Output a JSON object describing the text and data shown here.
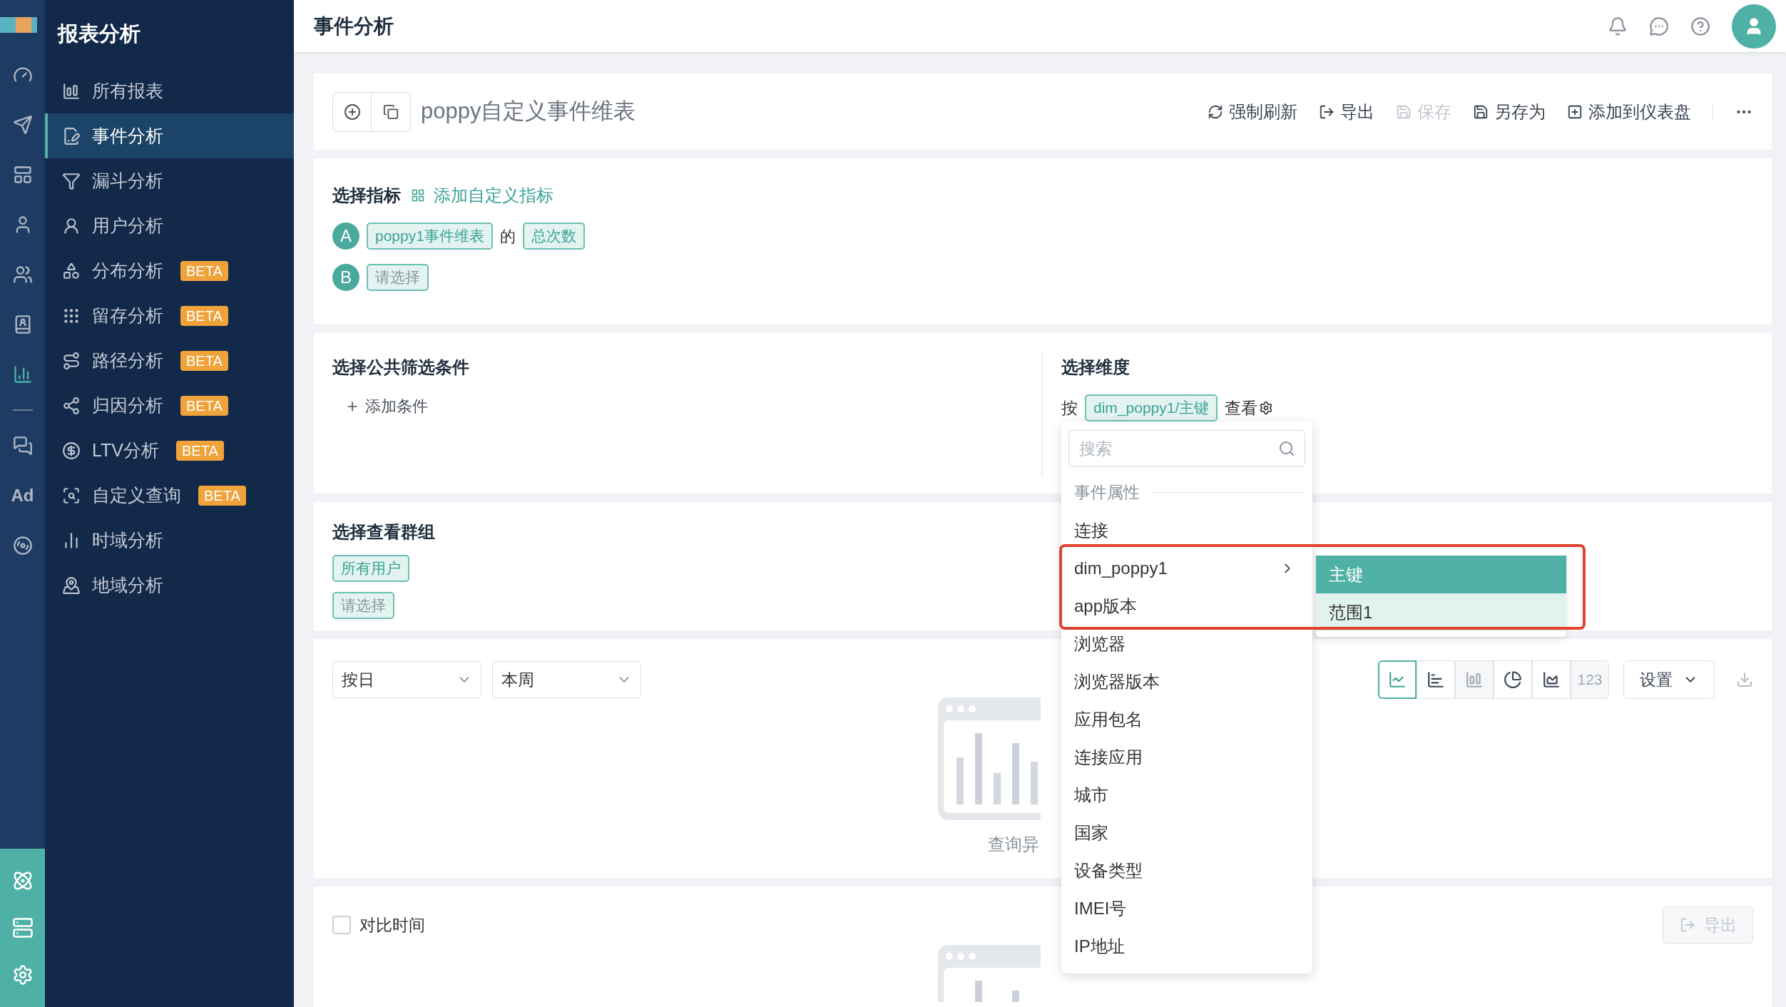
{
  "rail": {
    "items": [
      {
        "selected": false
      },
      {
        "selected": false
      },
      {
        "selected": false
      },
      {
        "selected": false
      },
      {
        "selected": false
      },
      {
        "selected": false
      },
      {
        "selected": true
      },
      {
        "selected": false
      },
      {
        "label": "Ad",
        "selected": false
      },
      {
        "selected": false
      }
    ]
  },
  "sidebar": {
    "title": "报表分析",
    "items": [
      {
        "label": "所有报表",
        "selected": false
      },
      {
        "label": "事件分析",
        "selected": true
      },
      {
        "label": "漏斗分析",
        "selected": false
      },
      {
        "label": "用户分析",
        "selected": false
      },
      {
        "label": "分布分析",
        "badge": "BETA",
        "selected": false
      },
      {
        "label": "留存分析",
        "badge": "BETA",
        "selected": false
      },
      {
        "label": "路径分析",
        "badge": "BETA",
        "selected": false
      },
      {
        "label": "归因分析",
        "badge": "BETA",
        "selected": false
      },
      {
        "label": "LTV分析",
        "badge": "BETA",
        "selected": false
      },
      {
        "label": "自定义查询",
        "badge": "BETA",
        "selected": false
      },
      {
        "label": "时域分析",
        "selected": false
      },
      {
        "label": "地域分析",
        "selected": false
      }
    ]
  },
  "header": {
    "title": "事件分析"
  },
  "report": {
    "title": "poppy自定义事件维表",
    "actions": [
      {
        "label": "强制刷新",
        "disabled": false
      },
      {
        "label": "导出",
        "disabled": false
      },
      {
        "label": "保存",
        "disabled": true
      },
      {
        "label": "另存为",
        "disabled": false
      },
      {
        "label": "添加到仪表盘",
        "disabled": false
      }
    ]
  },
  "metrics": {
    "heading": "选择指标",
    "add_link": "添加自定义指标",
    "rows": [
      {
        "letter": "A",
        "parts": [
          {
            "kind": "tag",
            "label": "poppy1事件维表"
          },
          {
            "kind": "word",
            "label": "的"
          },
          {
            "kind": "tag",
            "label": "总次数"
          }
        ]
      },
      {
        "letter": "B",
        "parts": [
          {
            "kind": "empty_tag",
            "label": "请选择"
          }
        ]
      }
    ]
  },
  "filters": {
    "heading": "选择公共筛选条件",
    "add": "添加条件"
  },
  "dimension": {
    "heading": "选择维度",
    "prefix": "按",
    "tag": "dim_poppy1/主键",
    "suffix": "查看"
  },
  "groups": {
    "heading": "选择查看群组",
    "tags": [
      {
        "kind": "tag",
        "label": "所有用户"
      },
      {
        "kind": "empty_tag",
        "label": "请选择"
      }
    ]
  },
  "chart_controls": {
    "selects": [
      {
        "value": "按日"
      },
      {
        "value": "本周"
      }
    ],
    "chart_types": [
      {
        "kind": "line",
        "selected": true,
        "disabled": false
      },
      {
        "kind": "bar",
        "selected": false,
        "disabled": false
      },
      {
        "kind": "stacked",
        "selected": false,
        "disabled": true
      },
      {
        "kind": "pie",
        "selected": false,
        "disabled": false
      },
      {
        "kind": "area",
        "selected": false,
        "disabled": false
      },
      {
        "kind": "number",
        "label": "123",
        "selected": false,
        "disabled": true
      }
    ],
    "settings": "设置"
  },
  "empty_state": {
    "text": "查询异"
  },
  "compare": {
    "checkbox": {
      "label": "对比时间",
      "checked": false
    },
    "export": {
      "label": "导出",
      "disabled": true
    }
  },
  "dropdown": {
    "search": {
      "placeholder": "搜索"
    },
    "group": "事件属性",
    "items": [
      {
        "label": "连接",
        "has_children": false
      },
      {
        "label": "dim_poppy1",
        "has_children": true
      },
      {
        "label": "app版本",
        "has_children": false
      },
      {
        "label": "浏览器",
        "has_children": false
      },
      {
        "label": "浏览器版本",
        "has_children": false
      },
      {
        "label": "应用包名",
        "has_children": false
      },
      {
        "label": "连接应用",
        "has_children": false
      },
      {
        "label": "城市",
        "has_children": false
      },
      {
        "label": "国家",
        "has_children": false
      },
      {
        "label": "设备类型",
        "has_children": false
      },
      {
        "label": "IMEI号",
        "has_children": false
      },
      {
        "label": "IP地址",
        "has_children": false
      }
    ],
    "submenu": [
      {
        "label": "主键",
        "selected": true
      },
      {
        "label": "范围1",
        "selected": false
      }
    ]
  }
}
